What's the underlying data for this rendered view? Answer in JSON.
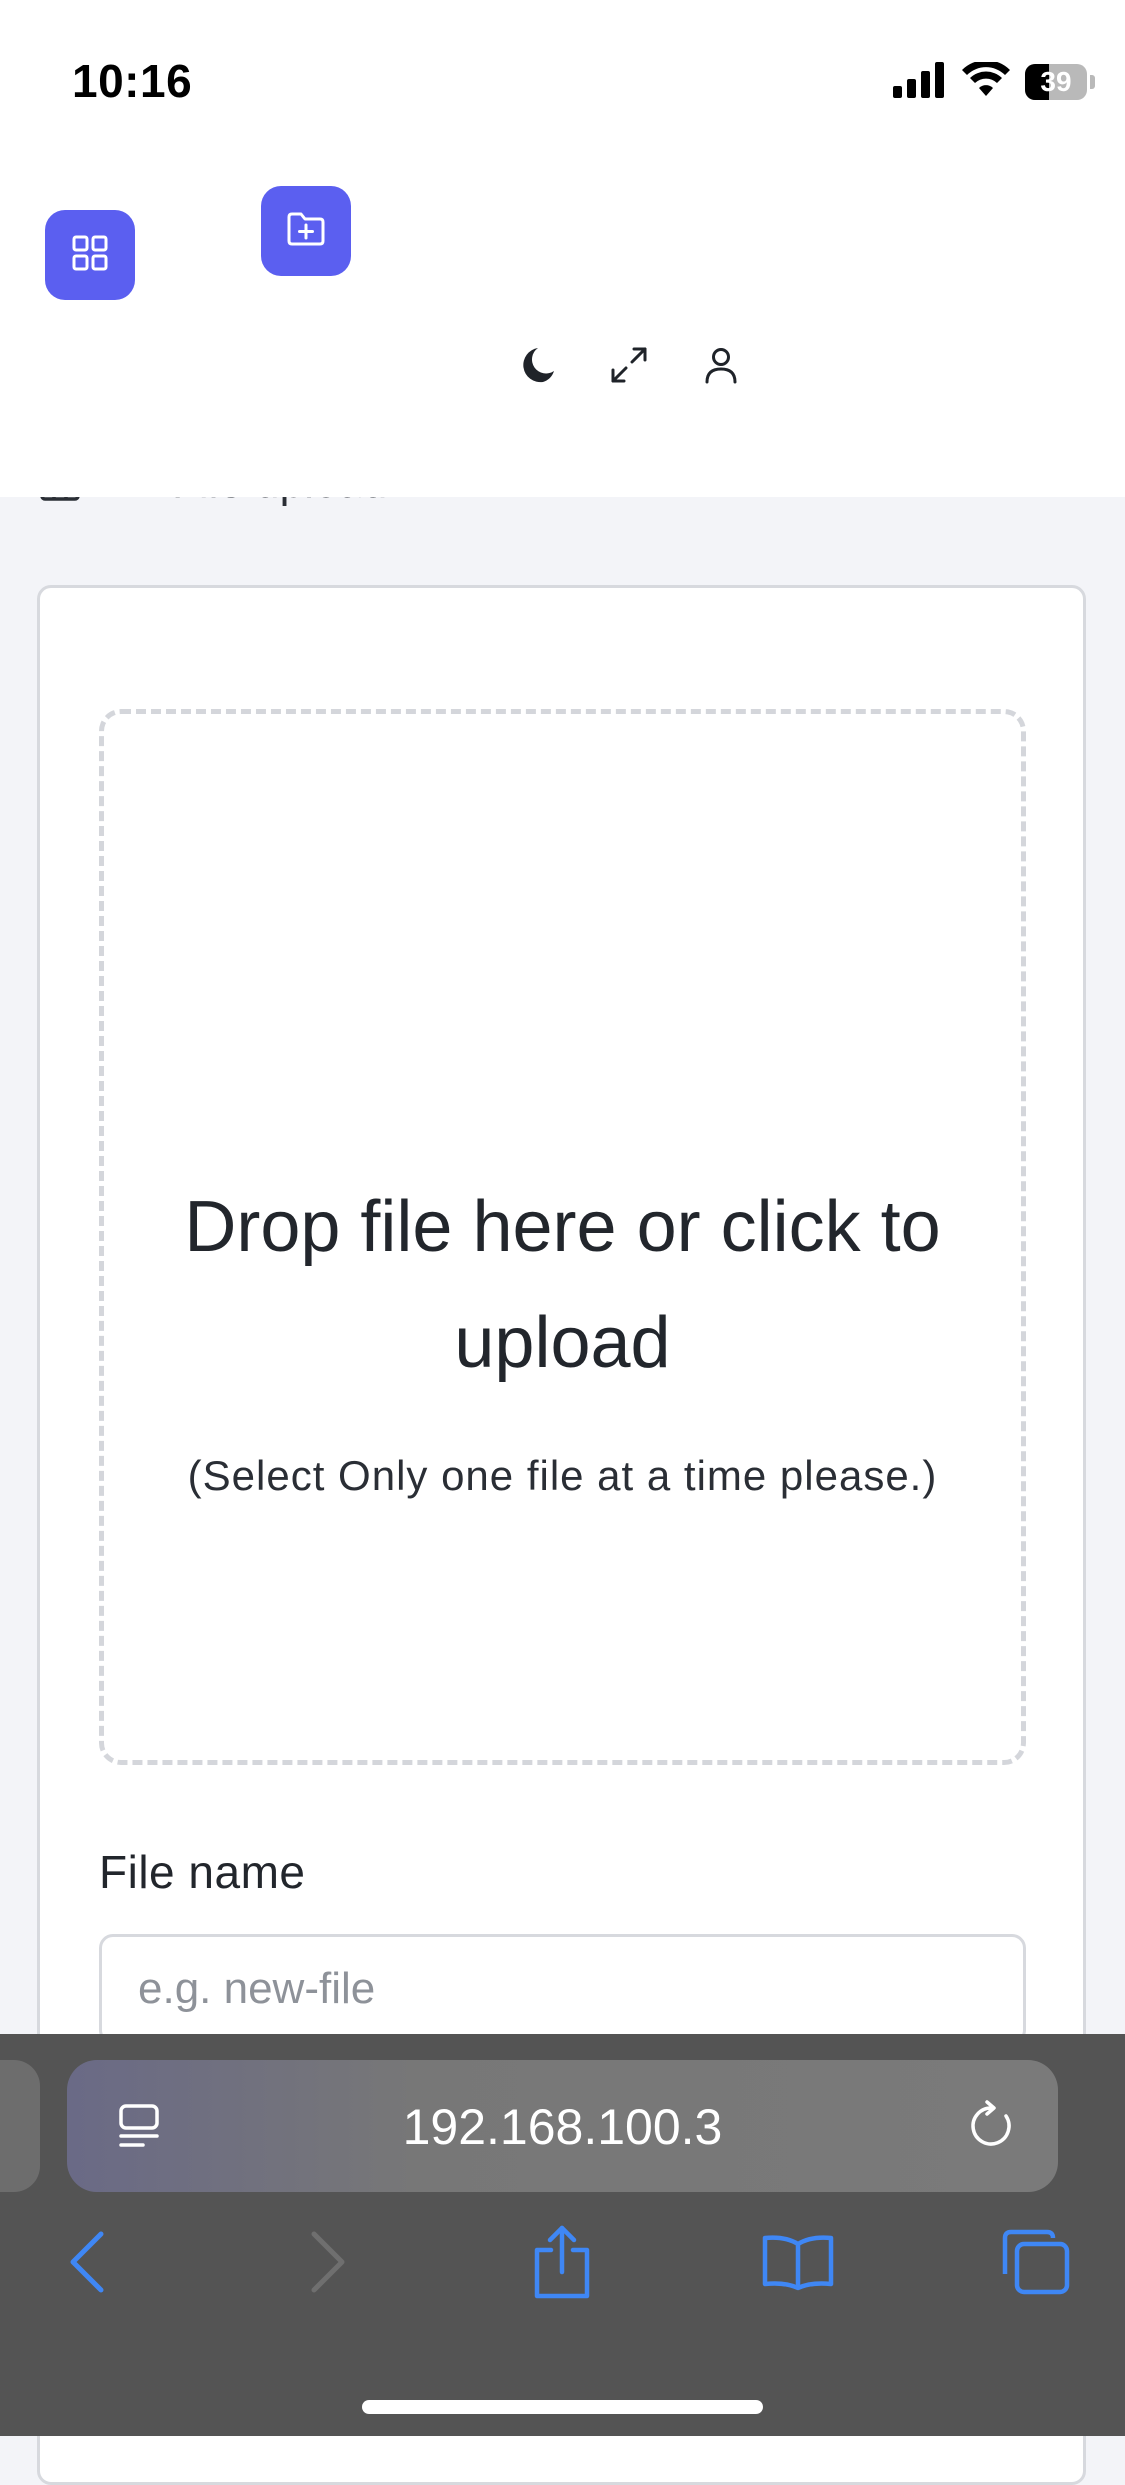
{
  "status_bar": {
    "time": "10:16",
    "battery_percent": "39",
    "battery_level": 0.39,
    "signal_icon": "cellular-signal-icon",
    "wifi_icon": "wifi-icon"
  },
  "header": {
    "grid_icon": "grid-icon",
    "new_folder_icon": "folder-plus-icon",
    "tools": [
      "moon-icon",
      "expand-icon",
      "user-icon"
    ]
  },
  "breadcrumb": {
    "home_icon": "home-icon",
    "separator_icon": "chevrons-right-icon",
    "current": "File upload"
  },
  "dropzone": {
    "title": "Drop file here or click to upload",
    "subtitle": "(Select Only one file at a time please.)"
  },
  "file_name": {
    "label": "File name",
    "placeholder": "e.g. new-file",
    "value": ""
  },
  "browser": {
    "url": "192.168.100.3",
    "page_menu_icon": "page-menu-icon",
    "reload_icon": "reload-icon",
    "nav_icons": [
      "back-icon",
      "forward-icon",
      "share-icon",
      "bookmarks-icon",
      "tabs-icon"
    ]
  },
  "colors": {
    "accent": "#5b5ff0",
    "browser_blue": "#3f87f5",
    "border": "#d7d9de",
    "page_bg": "#f3f4f8"
  }
}
